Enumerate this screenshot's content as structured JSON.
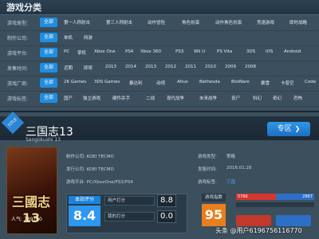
{
  "category_panel": {
    "title": "游戏分类",
    "all_label": "全部",
    "rows": [
      {
        "label": "游戏类型:",
        "options": [
          "第一人称射击",
          "第三人称射击",
          "动作冒险",
          "角色扮演",
          "动作角色扮演",
          "竞速游戏",
          "即时战略"
        ]
      },
      {
        "label": "制作公司:",
        "options": [
          "单机",
          "网游"
        ]
      },
      {
        "label": "游戏平台:",
        "options": [
          "PC",
          "掌机",
          "Xbox One",
          "PS4",
          "Xbox 360",
          "PS3",
          "Wii U",
          "PS Vita",
          "3DS",
          "iOS",
          "Android"
        ]
      },
      {
        "label": "发售时间:",
        "options": [
          "近期",
          "即将",
          "2013",
          "2014",
          "2013",
          "2012",
          "2011",
          "2010",
          "2009",
          "2008"
        ]
      },
      {
        "label": "游戏厂商:",
        "options": [
          "2K Games",
          "3DS Games",
          "暴达利",
          "动视",
          "Atlus",
          "Bethesda",
          "BioWare",
          "暴雪",
          "卡普空",
          "Code"
        ]
      },
      {
        "label": "游戏标签:",
        "options": [
          "国产",
          "独立游戏",
          "硬件杀手",
          "二战",
          "现代战争",
          "未来战争",
          "丧尸",
          "科幻",
          "奇幻",
          "恐怖"
        ]
      }
    ]
  },
  "game": {
    "ribbon": "TITLE",
    "title": "三国志13",
    "subtitle": "Sangokushi 13",
    "zone_button": "专区",
    "cover_logo": "三國志13",
    "cover_rating": "人气: 789790",
    "info": {
      "developer": "制作公司: KOEI TECMO",
      "publisher": "发行公司: KOEI TECMO",
      "platform": "游戏平台: PC/XboxOne/PS3/PS4",
      "type": "游戏类型:",
      "type_value": "策略",
      "release": "发售时间:",
      "release_value": "2016.01.28",
      "tag": "游戏标签:",
      "tag_value": "三国"
    },
    "scores": {
      "base_label": "本站评分",
      "base_value": "8.4",
      "user_label": "用户打分",
      "user_value": "8.8",
      "my_label": "我的打分",
      "my_value": "0.0"
    },
    "index": {
      "label": "游戏指数",
      "value": "95",
      "left_count": "5766",
      "right_count": "2867"
    }
  },
  "watermark": "头条 @用户6196756116770",
  "colors": {
    "accent_blue": "#1f8ee0",
    "score_blue": "#2e97f0",
    "index_orange": "#e87f1d",
    "bar_red": "#d5362e",
    "bar_blue": "#2d6fc4"
  }
}
